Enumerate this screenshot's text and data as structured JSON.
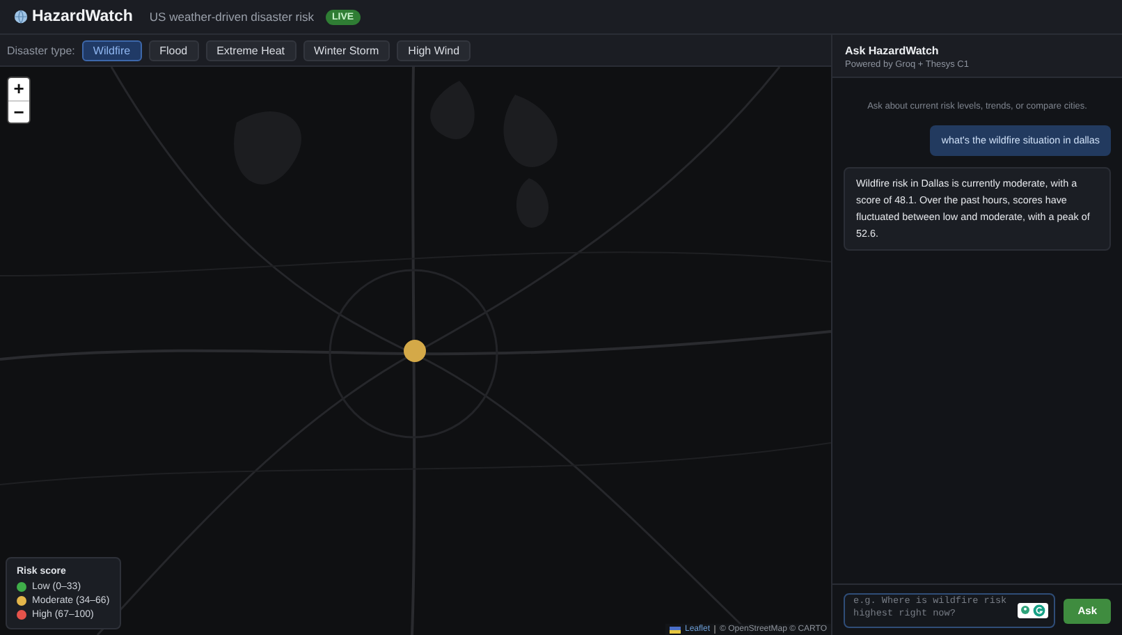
{
  "header": {
    "title": "HazardWatch",
    "subtitle": "US weather-driven disaster risk",
    "badge": "LIVE"
  },
  "filters": {
    "label": "Disaster type:",
    "options": [
      {
        "label": "Wildfire",
        "selected": true
      },
      {
        "label": "Flood",
        "selected": false
      },
      {
        "label": "Extreme Heat",
        "selected": false
      },
      {
        "label": "Winter Storm",
        "selected": false
      },
      {
        "label": "High Wind",
        "selected": false
      }
    ]
  },
  "map": {
    "zoom_controls": [
      "+",
      "−"
    ],
    "markers": [
      {
        "color": "#d4a948"
      }
    ],
    "legend": {
      "title": "Risk score",
      "items": [
        {
          "label": "Low (0–33)",
          "color": "#3fae49"
        },
        {
          "label": "Moderate (34–66)",
          "color": "#e3b54a"
        },
        {
          "label": "High (67–100)",
          "color": "#e5534b"
        }
      ]
    },
    "attribution": {
      "link": "Leaflet",
      "text": "© OpenStreetMap © CARTO"
    }
  },
  "chat": {
    "title": "Ask HazardWatch",
    "subtitle": "Powered by Groq + Thesys C1",
    "hint": "Ask about current risk levels, trends, or compare cities.",
    "messages": [
      {
        "kind": "user",
        "text": "what's the wildfire situation in dallas"
      },
      {
        "kind": "assistant",
        "text": "Wildfire risk in Dallas is currently moderate, with a score of 48.1. Over the past hours, scores have fluctuated between low and moderate, with a peak of 52.6."
      }
    ],
    "input": {
      "placeholder": "e.g. Where is wildfire risk highest right now?"
    },
    "send": "Ask"
  }
}
